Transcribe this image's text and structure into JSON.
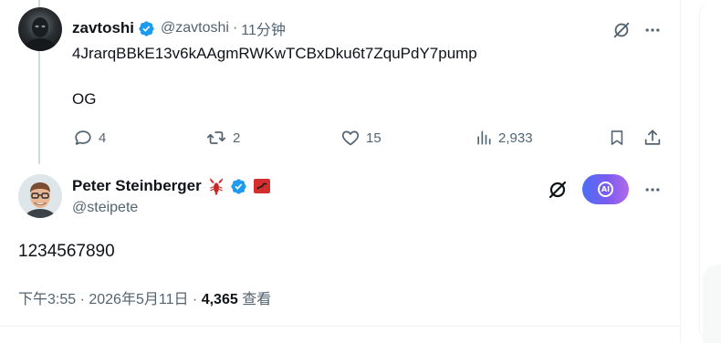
{
  "tweet1": {
    "author_name": "zavtoshi",
    "handle": "@zavtoshi",
    "separator": "·",
    "time": "11分钟",
    "line1": "4JrarqBBkE13v6kAAgmRWKwTCBxDku6t7ZquPdY7pump",
    "line2": "OG",
    "stats": {
      "replies": "4",
      "reposts": "2",
      "likes": "15",
      "views": "2,933"
    }
  },
  "tweet2": {
    "author_name": "Peter Steinberger",
    "handle": "@steipete",
    "grok_label": "AI",
    "text": "1234567890",
    "timestamp": "下午3:55 · 2026年5月11日 ·",
    "views_count": "4,365",
    "views_label": "查看"
  },
  "colors": {
    "verified": "#1d9bf0",
    "secondary_text": "#536471",
    "primary_text": "#0f1419",
    "thread_line": "#cfd9de",
    "divider": "#eff3f4"
  },
  "icons": {
    "verified": "verified-badge-icon",
    "grok": "grok-slash-icon",
    "more": "more-dots-icon",
    "reply": "reply-bubble-icon",
    "repost": "repost-arrows-icon",
    "like": "heart-icon",
    "views": "views-bars-icon",
    "bookmark": "bookmark-icon",
    "share": "share-icon",
    "lobster": "lobster-emoji-icon",
    "flag": "red-flag-emoji-icon"
  }
}
